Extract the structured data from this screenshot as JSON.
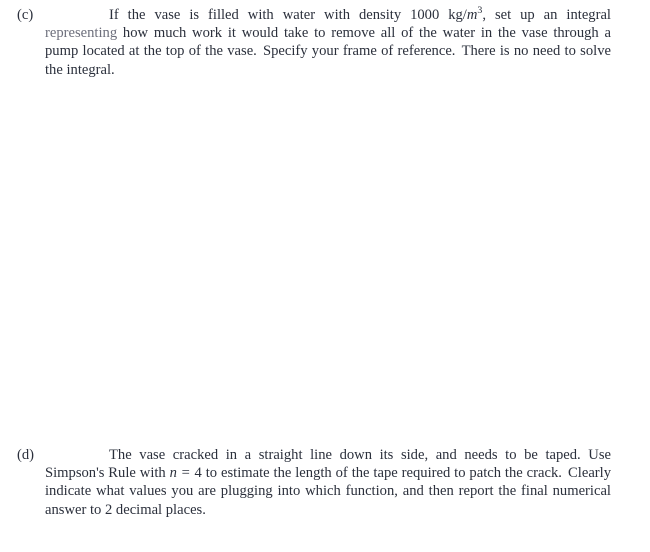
{
  "document": {
    "type": "math-worksheet",
    "text_color": "#2b303c",
    "background_color": "#ffffff"
  },
  "parts": {
    "c": {
      "label": "(c)",
      "text_before_math": "If the vase is filled with water with density 1000 kg/",
      "math": {
        "variable": "m",
        "exponent": "3",
        "rendered": "m³"
      },
      "text_after_math": ", set up an integral representing how much work it would take to remove all of the water in the vase through a pump located at the top of the vase.",
      "text_second_sentence": "Specify your frame of reference.",
      "text_third_sentence": "There is no need to solve the integral.",
      "faded_word": "representing",
      "full_text": "If the vase is filled with water with density 1000 kg/m³, set up an integral representing how much work it would take to remove all of the water in the vase through a pump located at the top of the vase. Specify your frame of reference. There is no need to solve the integral."
    },
    "d": {
      "label": "(d)",
      "text_before_math": "The vase cracked in a straight line down its side, and needs to be taped. Use Simpson's Rule with",
      "math": {
        "variable": "n",
        "relation": "=",
        "value": "4",
        "rendered": "n = 4"
      },
      "text_after_math": "to estimate the length of the tape required to patch the crack.",
      "text_second_sentence": "Clearly indicate what values you are plugging into which function, and then report the final numerical answer to 2 decimal places.",
      "full_text": "The vase cracked in a straight line down its side, and needs to be taped. Use Simpson's Rule with n = 4 to estimate the length of the tape required to patch the crack. Clearly indicate what values you are plugging into which function, and then report the final numerical answer to 2 decimal places."
    }
  },
  "answer_space": {
    "description": "blank work area between part (c) and part (d)"
  }
}
